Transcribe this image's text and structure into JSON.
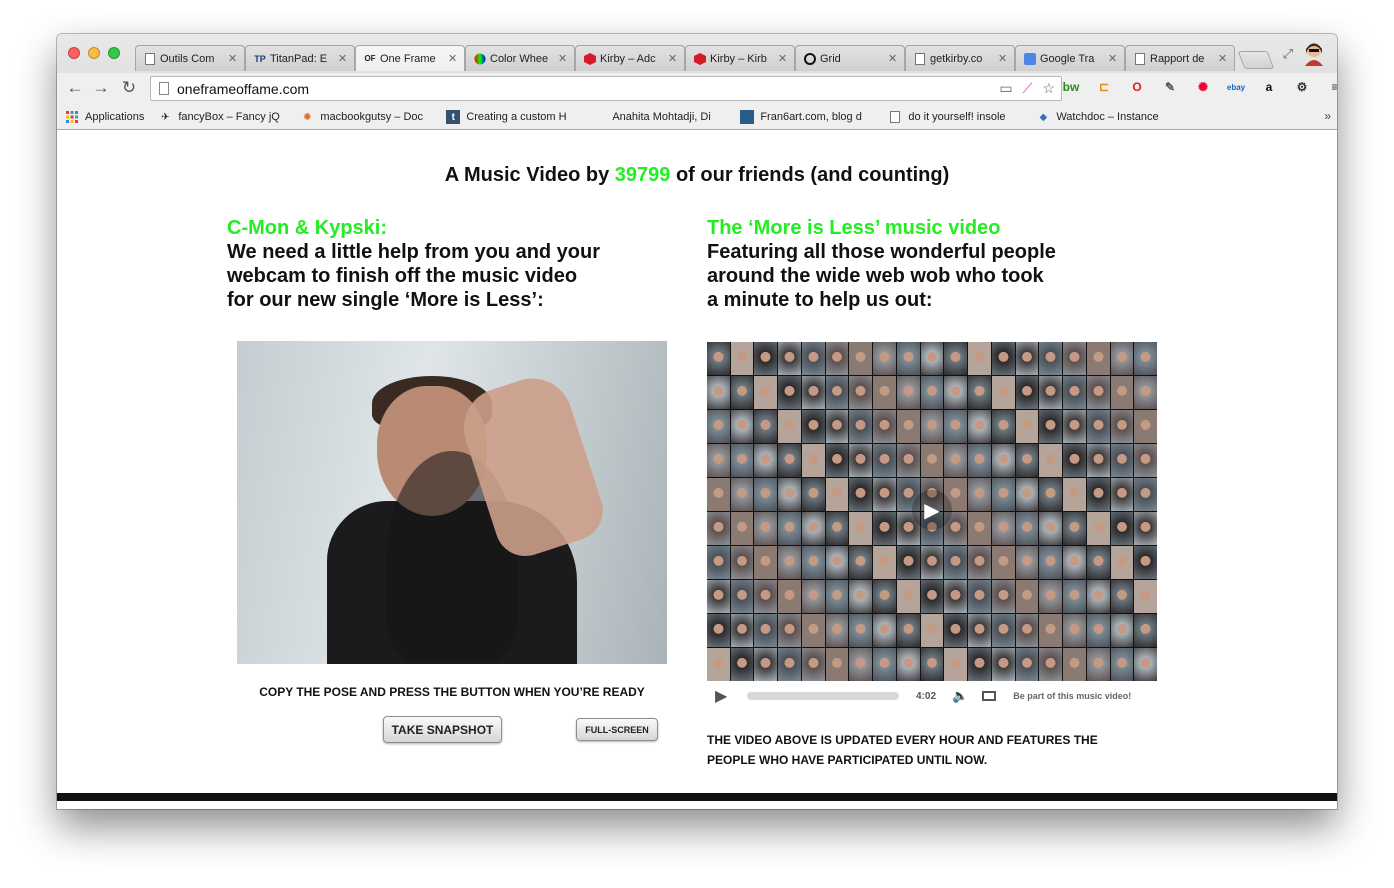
{
  "tabs": [
    {
      "label": "Outils Com",
      "icon": "page-icon",
      "active": false
    },
    {
      "label": "TitanPad: E",
      "icon": "tp-icon",
      "active": false
    },
    {
      "label": "One Frame",
      "icon": "ofof-icon",
      "active": true
    },
    {
      "label": "Color Whee",
      "icon": "color-wheel-icon",
      "active": false
    },
    {
      "label": "Kirby – Adc",
      "icon": "kirby-icon",
      "active": false
    },
    {
      "label": "Kirby – Kirb",
      "icon": "kirby-icon",
      "active": false
    },
    {
      "label": "Grid",
      "icon": "grid-icon",
      "active": false
    },
    {
      "label": "getkirby.co",
      "icon": "page-icon",
      "active": false
    },
    {
      "label": "Google Tra",
      "icon": "translate-icon",
      "active": false
    },
    {
      "label": "Rapport de",
      "icon": "page-icon",
      "active": false
    }
  ],
  "tab_fav_text": {
    "tp": "TP",
    "ofof": "OF"
  },
  "address": {
    "url": "oneframeoffame.com"
  },
  "bookmarks": [
    {
      "label": "Applications",
      "icon": "apps-grid-icon"
    },
    {
      "label": "fancyBox – Fancy jQ",
      "icon": "fancybox-icon"
    },
    {
      "label": "macbookgutsy – Doc",
      "icon": "ubuntu-icon"
    },
    {
      "label": "Creating a custom H",
      "icon": "tumblr-icon"
    },
    {
      "label": "Anahita Mohtadji, Di",
      "icon": "apple-icon"
    },
    {
      "label": "Fran6art.com, blog d",
      "icon": "photo-icon"
    },
    {
      "label": "do it yourself! insole",
      "icon": "page-icon"
    },
    {
      "label": "Watchdoc – Instance",
      "icon": "watchdoc-icon"
    }
  ],
  "bookmarks_more": "»",
  "page": {
    "headline_prefix": "A Music Video by ",
    "headline_count": "39799",
    "headline_suffix": " of our friends (and counting)",
    "left_title": "C-Mon & Kypski:",
    "left_body": [
      "We need a little help from you and your",
      "webcam to finish off the music video",
      "for our new single ‘More is Less’:"
    ],
    "right_title": "The ‘More is Less’ music video",
    "right_body": [
      "Featuring all those wonderful people",
      "around the wide web wob who took",
      "a minute to help us out:"
    ],
    "caption": "COPY THE POSE AND PRESS THE BUTTON WHEN YOU’RE READY",
    "snapshot_button": "TAKE SNAPSHOT",
    "fullscreen_button": "FULL-SCREEN",
    "video_time": "4:02",
    "video_cta": "Be part of this music video!",
    "notice": [
      "THE VIDEO ABOVE IS UPDATED EVERY HOUR AND FEATURES THE",
      "PEOPLE WHO HAVE PARTICIPATED UNTIL NOW."
    ]
  },
  "colors": {
    "accent_green": "#22ee22"
  }
}
